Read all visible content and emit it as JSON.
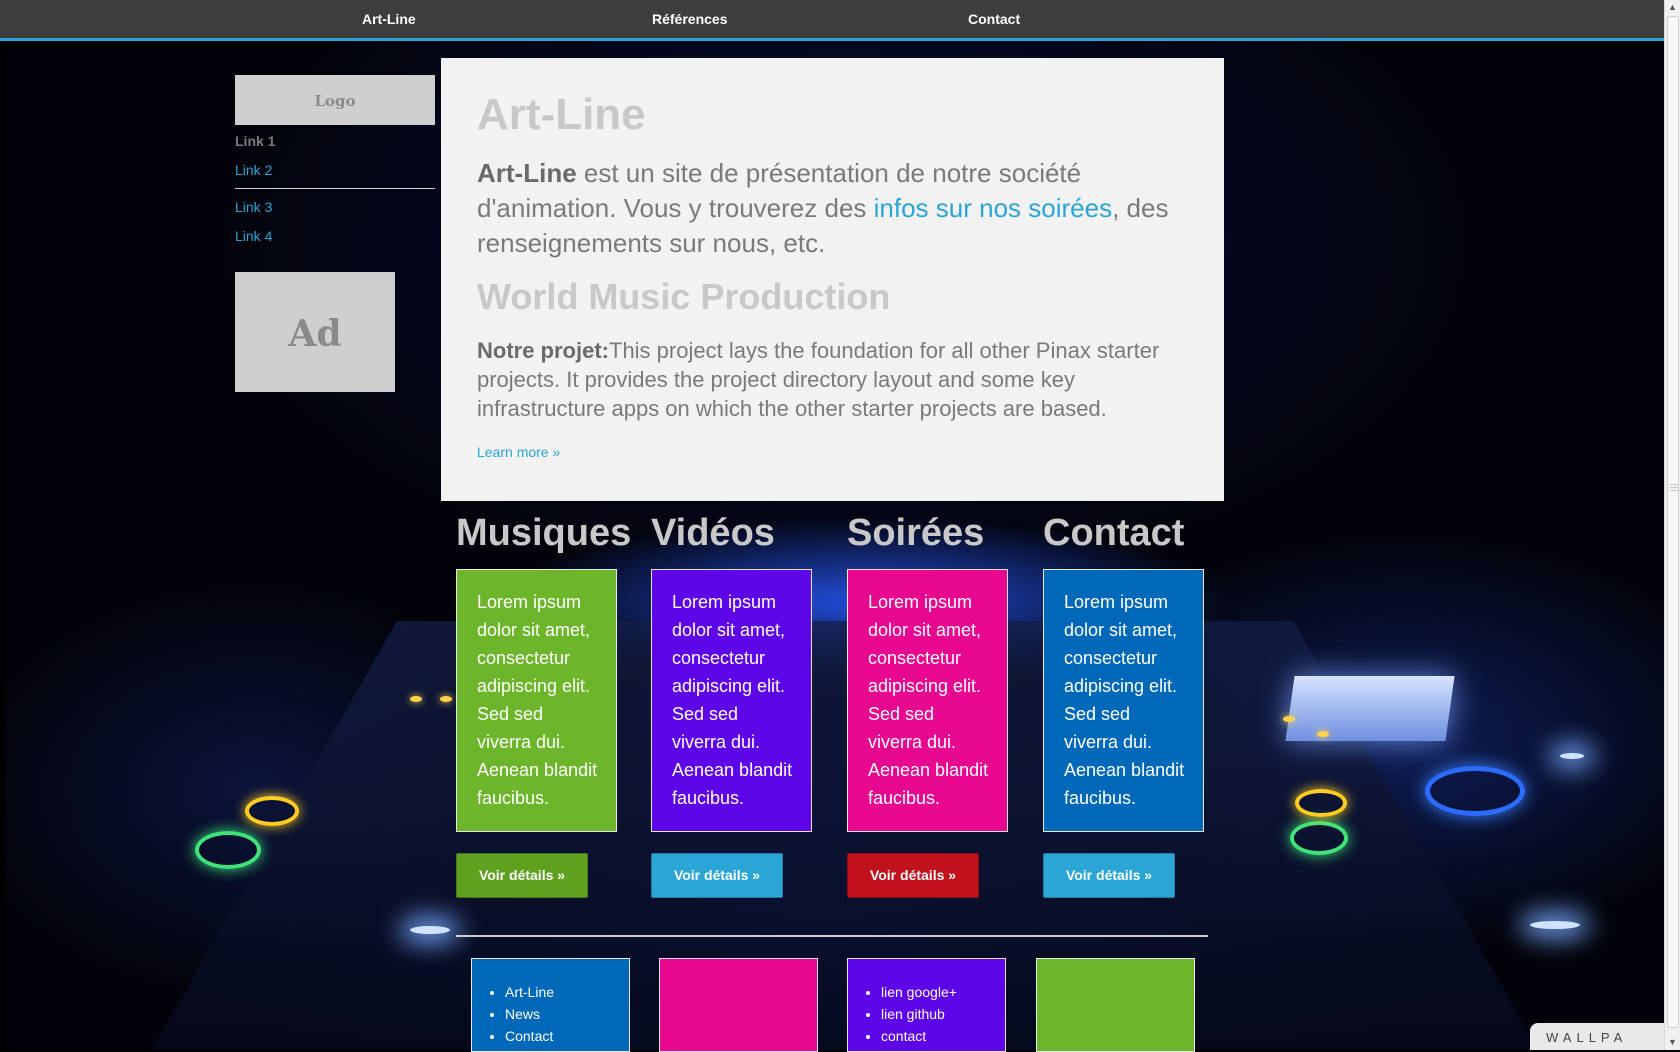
{
  "nav": {
    "items": [
      "Art-Line",
      "Références",
      "Contact"
    ]
  },
  "sidebar": {
    "logo": "Logo",
    "links": [
      "Link 1",
      "Link 2",
      "Link 3",
      "Link 4"
    ],
    "active_index": 0,
    "ad": "Ad"
  },
  "hero": {
    "title": "Art-Line",
    "lead_bold": "Art-Line",
    "lead_text1": " est un site de présentation de notre société d'animation. Vous y trouverez des ",
    "lead_link": "infos sur nos soirées",
    "lead_text2": ", des renseignements sur nous, etc.",
    "subtitle": "World Music Production",
    "project_bold": "Notre projet:",
    "project_text": "This project lays the foundation for all other Pinax starter projects. It provides the project directory layout and some key infrastructure apps on which the other starter projects are based.",
    "learn_more": "Learn more »"
  },
  "columns": [
    {
      "title": "Musiques",
      "text": "Lorem ipsum dolor sit amet, consectetur adipiscing elit. Sed sed viverra dui. Aenean blandit faucibus.",
      "button": "Voir détails »",
      "box_color": "#6db52a",
      "button_color": "#5fa11f"
    },
    {
      "title": "Vidéos",
      "text": "Lorem ipsum dolor sit amet, consectetur adipiscing elit. Sed sed viverra dui. Aenean blandit faucibus.",
      "button": "Voir détails »",
      "box_color": "#5d06e8",
      "button_color": "#2aa5d6"
    },
    {
      "title": "Soirées",
      "text": "Lorem ipsum dolor sit amet, consectetur adipiscing elit. Sed sed viverra dui. Aenean blandit faucibus.",
      "button": "Voir détails »",
      "box_color": "#e8078f",
      "button_color": "#c0111c"
    },
    {
      "title": "Contact",
      "text": "Lorem ipsum dolor sit amet, consectetur adipiscing elit. Sed sed viverra dui. Aenean blandit faucibus.",
      "button": "Voir détails »",
      "box_color": "#0068b8",
      "button_color": "#2aa5d6"
    }
  ],
  "footer": {
    "boxes": [
      {
        "color": "#0068b8",
        "items": [
          "Art-Line",
          "News",
          "Contact"
        ]
      },
      {
        "color": "#e8078f",
        "items": []
      },
      {
        "color": "#5d06e8",
        "items": [
          "lien google+",
          "lien github",
          "contact"
        ]
      },
      {
        "color": "#6db52a",
        "items": []
      }
    ]
  },
  "badge": "WALLPA"
}
